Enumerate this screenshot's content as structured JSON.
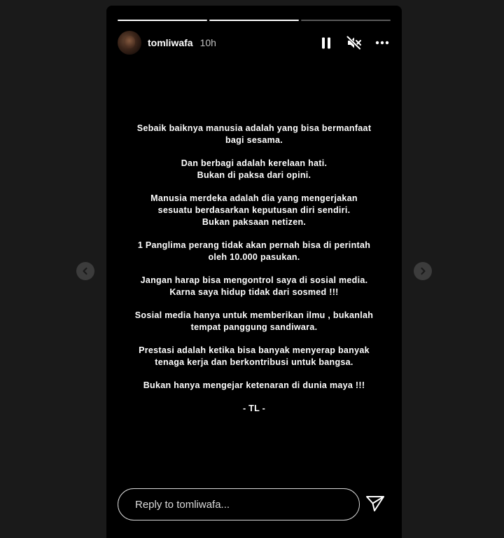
{
  "progress": [
    {
      "fill": 1
    },
    {
      "fill": 1
    },
    {
      "fill": 0
    }
  ],
  "header": {
    "username": "tomliwafa",
    "time": "10h",
    "icons": {
      "pause": "pause-icon",
      "mute": "muted-speaker-icon",
      "more": "more-dots-icon"
    }
  },
  "content": {
    "paragraphs": [
      {
        "lines": [
          "Sebaik baiknya manusia adalah yang bisa bermanfaat",
          "bagi sesama."
        ]
      },
      {
        "lines": [
          "Dan berbagi adalah kerelaan hati.",
          "Bukan di paksa dari opini."
        ]
      },
      {
        "lines": [
          "Manusia merdeka adalah dia yang mengerjakan",
          "sesuatu berdasarkan keputusan diri sendiri.",
          "Bukan paksaan netizen."
        ]
      },
      {
        "lines": [
          "1 Panglima perang tidak akan pernah bisa di perintah",
          "oleh 10.000 pasukan."
        ]
      },
      {
        "lines": [
          "Jangan harap bisa mengontrol saya di sosial media.",
          "Karna saya hidup tidak dari sosmed !!!"
        ]
      },
      {
        "lines": [
          "Sosial media hanya untuk memberikan ilmu , bukanlah",
          "tempat panggung sandiwara."
        ]
      },
      {
        "lines": [
          "Prestasi adalah ketika bisa banyak menyerap banyak",
          "tenaga kerja dan berkontribusi untuk bangsa."
        ]
      },
      {
        "lines": [
          "Bukan hanya mengejar ketenaran di dunia maya !!!"
        ]
      },
      {
        "lines": [
          "- TL -"
        ]
      }
    ]
  },
  "reply": {
    "placeholder": "Reply to tomliwafa...",
    "value": ""
  },
  "nav": {
    "prev_icon": "chevron-left-icon",
    "next_icon": "chevron-right-icon"
  },
  "send_icon": "paper-plane-icon"
}
